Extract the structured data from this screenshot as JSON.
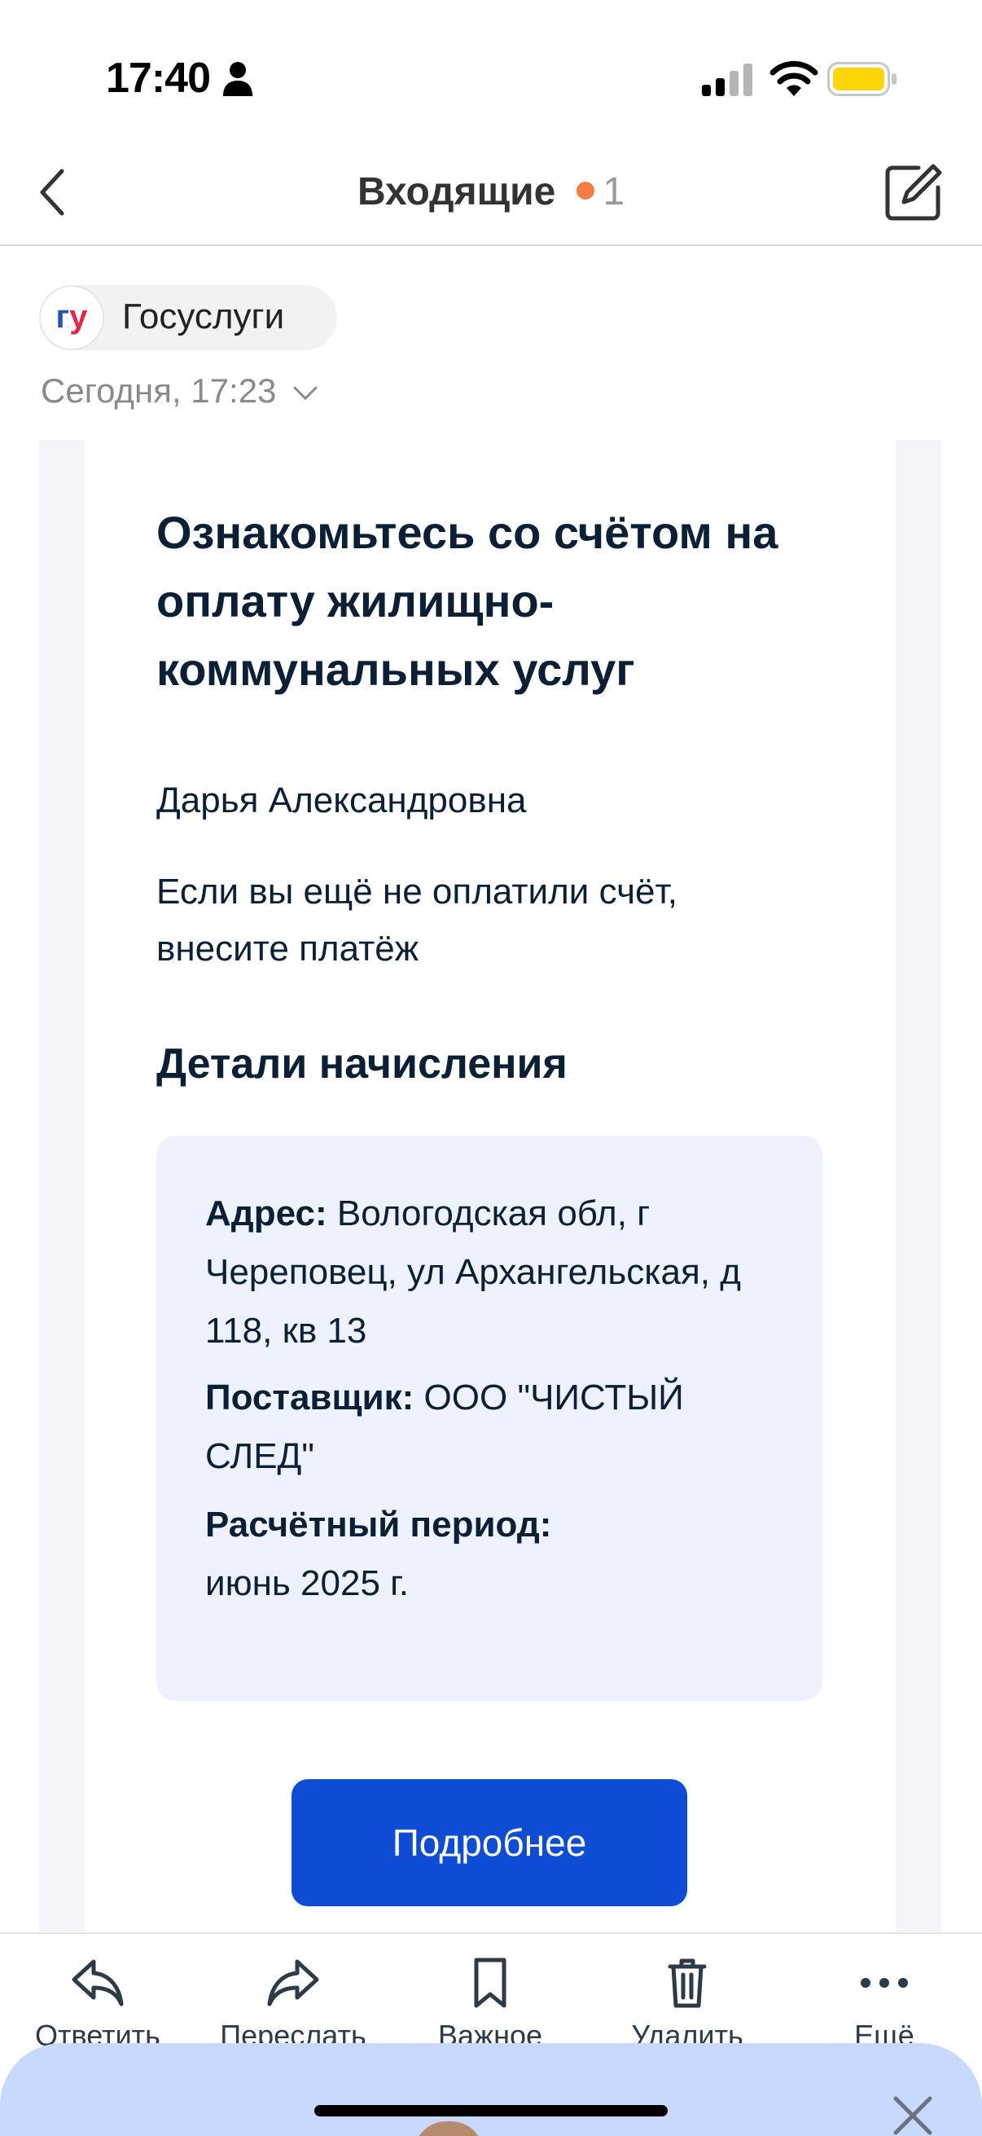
{
  "status_bar": {
    "time": "17:40"
  },
  "nav": {
    "title": "Входящие",
    "unread_count": "1"
  },
  "sender": {
    "avatar_g": "г",
    "avatar_u": "у",
    "name": "Госуслуги",
    "date": "Сегодня, 17:23"
  },
  "email": {
    "heading": "Ознакомьтесь со счётом на оплату жилищно-коммунальных услуг",
    "greeting": "Дарья Александровна",
    "notice": "Если вы ещё не оплатили счёт, внесите платёж",
    "details_title": "Детали начисления",
    "details": {
      "address_label": "Адрес:",
      "address_value": "Вологодская обл, г Череповец, ул Архангельская, д 118, кв 13",
      "supplier_label": "Поставщик:",
      "supplier_value": "ООО \"ЧИСТЫЙ СЛЕД\"",
      "period_label": "Расчётный период:",
      "period_value": "июнь 2025 г."
    },
    "more_button": "Подробнее"
  },
  "toolbar": {
    "reply": "Ответить",
    "forward": "Переслать",
    "important": "Важное",
    "delete": "Удалить",
    "more": "Ещё"
  },
  "colors": {
    "accent_button": "#0d4cd3",
    "unread_dot": "#f57d44",
    "details_bg": "#edf2fe",
    "sheet_bg": "#c8d9fd",
    "battery": "#ffd60a"
  }
}
